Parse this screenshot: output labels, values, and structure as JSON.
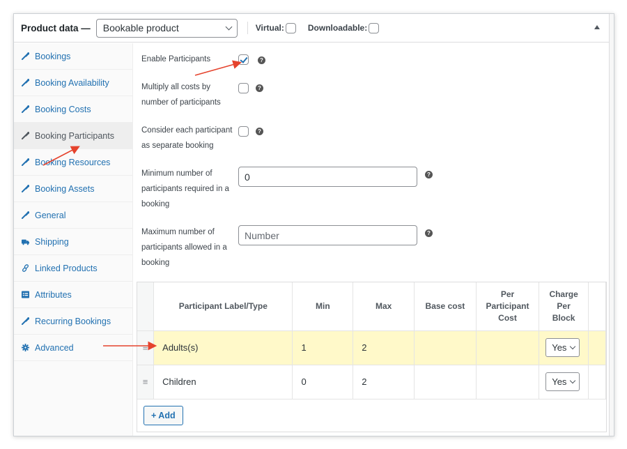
{
  "header": {
    "title": "Product data —",
    "product_type": "Bookable product",
    "virtual_label": "Virtual:",
    "virtual_checked": false,
    "downloadable_label": "Downloadable:",
    "downloadable_checked": false,
    "collapse_icon": "triangle-up-icon"
  },
  "sidebar": {
    "items": [
      {
        "label": "Bookings",
        "icon": "wrench-icon",
        "active": false
      },
      {
        "label": "Booking Availability",
        "icon": "wrench-icon",
        "active": false
      },
      {
        "label": "Booking Costs",
        "icon": "wrench-icon",
        "active": false
      },
      {
        "label": "Booking Participants",
        "icon": "wrench-icon",
        "active": true
      },
      {
        "label": "Booking Resources",
        "icon": "wrench-icon",
        "active": false
      },
      {
        "label": "Booking Assets",
        "icon": "wrench-icon",
        "active": false
      },
      {
        "label": "General",
        "icon": "wrench-icon",
        "active": false
      },
      {
        "label": "Shipping",
        "icon": "truck-icon",
        "active": false
      },
      {
        "label": "Linked Products",
        "icon": "link-icon",
        "active": false
      },
      {
        "label": "Attributes",
        "icon": "list-icon",
        "active": false
      },
      {
        "label": "Recurring Bookings",
        "icon": "wrench-icon",
        "active": false
      },
      {
        "label": "Advanced",
        "icon": "gear-icon",
        "active": false
      }
    ]
  },
  "fields": {
    "enable_participants": {
      "label": "Enable Participants",
      "checked": true
    },
    "multiply_costs": {
      "label_line1": "Multiply all costs by",
      "label_line2": "number of participants",
      "checked": false
    },
    "separate_booking": {
      "label_line1": "Consider each participant",
      "label_line2": "as separate booking",
      "checked": false
    },
    "min_participants": {
      "label_line1": "Minimum number of",
      "label_line2": "participants required in a",
      "label_line3": "booking",
      "value": "0"
    },
    "max_participants": {
      "label_line1": "Maximum number of",
      "label_line2": "participants allowed in a",
      "label_line3": "booking",
      "value": "",
      "placeholder": "Number"
    },
    "help_icon": "question-circle-icon"
  },
  "table": {
    "headers": {
      "label": "Participant Label/Type",
      "min": "Min",
      "max": "Max",
      "base_cost": "Base cost",
      "per_participant_1": "Per",
      "per_participant_2": "Participant",
      "per_participant_3": "Cost",
      "charge_1": "Charge",
      "charge_2": "Per",
      "charge_3": "Block"
    },
    "rows": [
      {
        "label": "Adults(s)",
        "min": "1",
        "max": "2",
        "base_cost": "",
        "per_participant_cost": "",
        "charge_per_block": "Yes",
        "highlighted": true
      },
      {
        "label": "Children",
        "min": "0",
        "max": "2",
        "base_cost": "",
        "per_participant_cost": "",
        "charge_per_block": "Yes",
        "highlighted": false
      }
    ],
    "add_button": "+ Add"
  },
  "colors": {
    "accent": "#2271b1",
    "annotation_arrow": "#e5432d",
    "highlight_row": "#fff9c9"
  }
}
